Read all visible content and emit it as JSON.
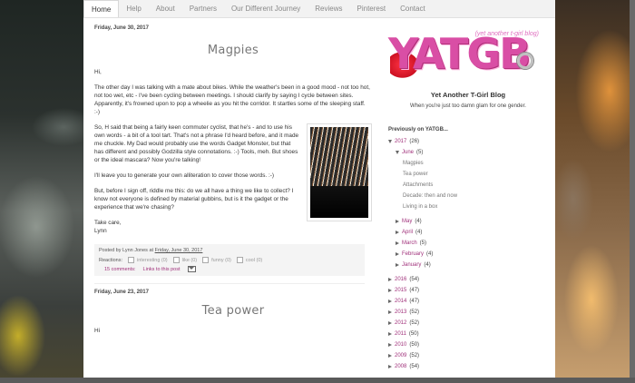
{
  "nav": {
    "items": [
      "Home",
      "Help",
      "About",
      "Partners",
      "Our Different Journey",
      "Reviews",
      "Pinterest",
      "Contact"
    ],
    "active": 0
  },
  "post1": {
    "date": "Friday, June 30, 2017",
    "title": "Magpies",
    "paragraphs": [
      "Hi,",
      "The other day I was talking with a mate about bikes. While the weather's been in a good mood - not too hot, not too wet, etc - I've been cycling between meetings. I should clarify by saying I cycle between sites. Apparently, it's frowned upon to pop a wheelie as you hit the corridor. It startles some of the sleeping staff. :-)",
      "So, H said that being a fairly keen commuter cyclist, that he's - and to use his own words - a bit of a tool tart. That's not a phrase I'd heard before, and it made me chuckle. My Dad would probably use the words Gadget Monster, but that has different and possibly Godzilla style connotations. :-) Tools, meh. But shoes or the ideal mascara? Now you're talking!",
      "I'll leave you to generate your own alliteration to cover those words. :-)",
      "But, before I sign off, riddle me this: do we all have a thing we like to collect? I know not everyone is defined by material gubbins, but is it the gadget or the experience that we're chasing?",
      "Take care,",
      "Lynn"
    ],
    "footer": {
      "posted_by_prefix": "Posted by",
      "author": "Lynn Jones",
      "at": "at",
      "timestamp": "Friday, June 30, 2017",
      "reactions_label": "Reactions:",
      "reactions": [
        {
          "label": "interesting (0)"
        },
        {
          "label": "like (0)"
        },
        {
          "label": "funny (0)"
        },
        {
          "label": "cool (0)"
        }
      ],
      "comments": "15 comments:",
      "links": "Links to this post"
    }
  },
  "post2": {
    "date": "Friday, June 23, 2017",
    "title": "Tea power",
    "first_line": "Hi"
  },
  "sidebar": {
    "logo_letters": "YATGB",
    "logo_tagline": "(yet another t-girl blog)",
    "blog_title": "Yet Another T-Girl Blog",
    "blog_desc": "When you're just too damn glam for one gender.",
    "prev_heading": "Previously on YATGB...",
    "archive": {
      "year_2017": {
        "year": "2017",
        "count": "(26)"
      },
      "june": {
        "month": "June",
        "count": "(5)"
      },
      "june_posts": [
        "Magpies",
        "Tea power",
        "Attachments",
        "Decade: then and now",
        "Living in a box"
      ],
      "months": [
        {
          "month": "May",
          "count": "(4)"
        },
        {
          "month": "April",
          "count": "(4)"
        },
        {
          "month": "March",
          "count": "(5)"
        },
        {
          "month": "February",
          "count": "(4)"
        },
        {
          "month": "January",
          "count": "(4)"
        }
      ],
      "years": [
        {
          "year": "2016",
          "count": "(54)"
        },
        {
          "year": "2015",
          "count": "(47)"
        },
        {
          "year": "2014",
          "count": "(47)"
        },
        {
          "year": "2013",
          "count": "(52)"
        },
        {
          "year": "2012",
          "count": "(52)"
        },
        {
          "year": "2011",
          "count": "(50)"
        },
        {
          "year": "2010",
          "count": "(50)"
        },
        {
          "year": "2009",
          "count": "(52)"
        },
        {
          "year": "2008",
          "count": "(54)"
        }
      ]
    }
  }
}
